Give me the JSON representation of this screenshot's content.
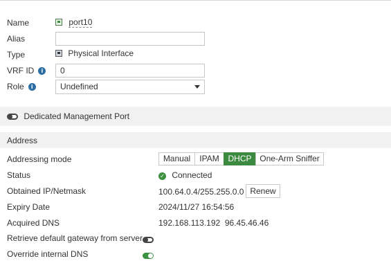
{
  "form": {
    "name_label": "Name",
    "name_value": "port10",
    "alias_label": "Alias",
    "alias_value": "",
    "type_label": "Type",
    "type_value": "Physical Interface",
    "vrf_label": "VRF ID",
    "vrf_value": "0",
    "role_label": "Role",
    "role_value": "Undefined"
  },
  "mgmt": {
    "label": "Dedicated Management Port",
    "enabled": false
  },
  "address": {
    "section_title": "Address",
    "mode_label": "Addressing mode",
    "modes": [
      "Manual",
      "IPAM",
      "DHCP",
      "One-Arm Sniffer"
    ],
    "active_mode": "DHCP",
    "status_label": "Status",
    "status_value": "Connected",
    "ip_label": "Obtained IP/Netmask",
    "ip_value": "100.64.0.4/255.255.0.0",
    "renew_label": "Renew",
    "expiry_label": "Expiry Date",
    "expiry_value": "2024/11/27 16:54:56",
    "dns_label": "Acquired DNS",
    "dns_value": "192.168.113.192  96.45.46.46",
    "gateway_label": "Retrieve default gateway from server",
    "gateway_enabled": false,
    "override_dns_label": "Override internal DNS",
    "override_dns_enabled": true
  },
  "icons": {
    "info": "info-icon",
    "port": "port-icon",
    "physical": "physical-interface-icon",
    "connected": "check-circle-icon",
    "dropdown": "chevron-down-icon"
  },
  "colors": {
    "accent_green": "#3c8a3f",
    "info_blue": "#2c6ea4",
    "section_bg": "#f1f1f1"
  }
}
